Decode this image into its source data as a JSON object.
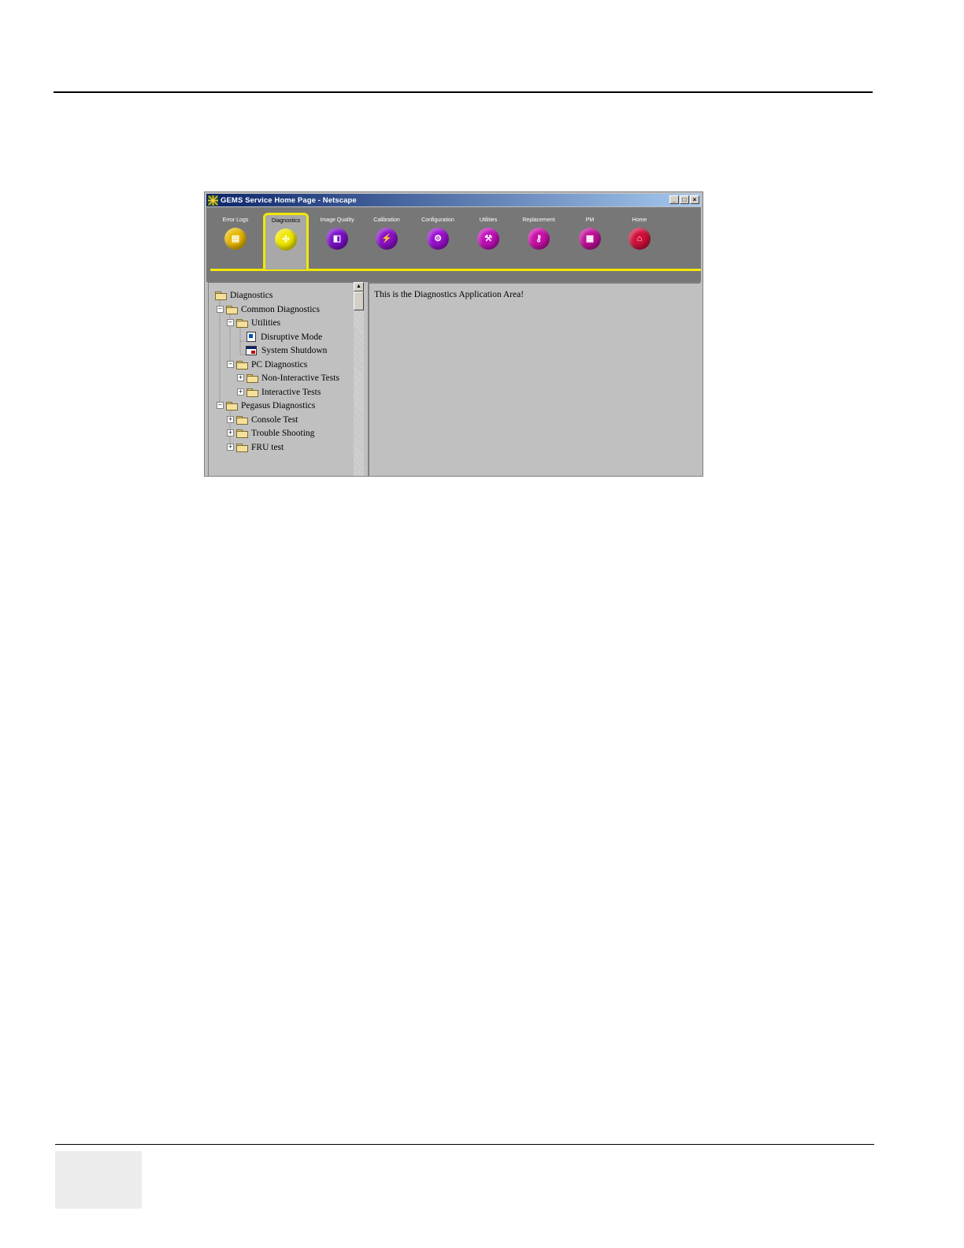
{
  "window": {
    "title": "GEMS Service Home Page - Netscape",
    "controls": [
      "_",
      "□",
      "×"
    ]
  },
  "toolbar": {
    "tools": [
      {
        "label": "Error Logs",
        "color": "#e8b800",
        "icon": "log-icon",
        "active": false
      },
      {
        "label": "Diagnostics",
        "color": "#f0e800",
        "icon": "diagnostics-icon",
        "active": true
      },
      {
        "label": "Image Quality",
        "color": "#7a10c8",
        "icon": "image-quality-icon",
        "active": false
      },
      {
        "label": "Calibration",
        "color": "#8a10c8",
        "icon": "calibration-icon",
        "active": false
      },
      {
        "label": "Configuration",
        "color": "#9a10d0",
        "icon": "configuration-icon",
        "active": false
      },
      {
        "label": "Utilities",
        "color": "#c010b8",
        "icon": "utilities-icon",
        "active": false
      },
      {
        "label": "Replacement",
        "color": "#c810a8",
        "icon": "replacement-icon",
        "active": false
      },
      {
        "label": "PM",
        "color": "#c01098",
        "icon": "pm-icon",
        "active": false
      },
      {
        "label": "Home",
        "color": "#d0103a",
        "icon": "home-icon",
        "active": false
      }
    ],
    "accent_color": "#f0e800"
  },
  "tree": {
    "items": [
      {
        "label": "Diagnostics",
        "icon": "folder-open-icon"
      },
      {
        "label": "Common Diagnostics",
        "icon": "folder-open-icon",
        "expander": "−"
      },
      {
        "label": "Utilities",
        "icon": "folder-open-icon",
        "expander": "−"
      },
      {
        "label": "Disruptive Mode",
        "icon": "document-icon"
      },
      {
        "label": "System Shutdown",
        "icon": "window-icon"
      },
      {
        "label": "PC Diagnostics",
        "icon": "folder-open-icon",
        "expander": "−"
      },
      {
        "label": "Non-Interactive Tests",
        "icon": "folder-icon",
        "expander": "+"
      },
      {
        "label": "Interactive Tests",
        "icon": "folder-icon",
        "expander": "+"
      },
      {
        "label": "Pegasus Diagnostics",
        "icon": "folder-open-icon",
        "expander": "−"
      },
      {
        "label": "Console Test",
        "icon": "folder-icon",
        "expander": "+"
      },
      {
        "label": "Trouble Shooting",
        "icon": "folder-icon",
        "expander": "+"
      },
      {
        "label": "FRU test",
        "icon": "folder-icon",
        "expander": "+"
      }
    ]
  },
  "app_area": {
    "text": "This is the Diagnostics Application Area!"
  }
}
